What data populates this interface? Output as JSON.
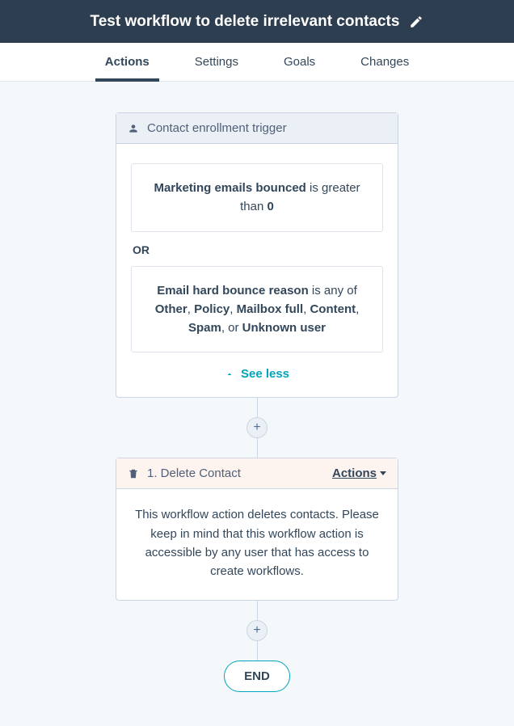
{
  "header": {
    "title": "Test workflow to delete irrelevant contacts"
  },
  "tabs": {
    "items": [
      {
        "label": "Actions",
        "active": true
      },
      {
        "label": "Settings",
        "active": false
      },
      {
        "label": "Goals",
        "active": false
      },
      {
        "label": "Changes",
        "active": false
      }
    ]
  },
  "trigger": {
    "header": "Contact enrollment trigger",
    "criteria1": {
      "field": "Marketing emails bounced",
      "op": " is greater than ",
      "value": "0"
    },
    "or_label": "OR",
    "criteria2": {
      "field": "Email hard bounce reason",
      "op": " is any of ",
      "v1": "Other",
      "v2": "Policy",
      "v3": "Mailbox full",
      "v4": "Content",
      "v5": "Spam",
      "v6": "Unknown user",
      "sep_comma": ", ",
      "sep_or": ", or "
    },
    "see_less": "See less"
  },
  "action1": {
    "header": "1. Delete Contact",
    "actions_label": "Actions",
    "body": "This workflow action deletes contacts. Please keep in mind that this workflow action is accessible by any user that has access to create workflows."
  },
  "end_label": "END",
  "plus": "+"
}
